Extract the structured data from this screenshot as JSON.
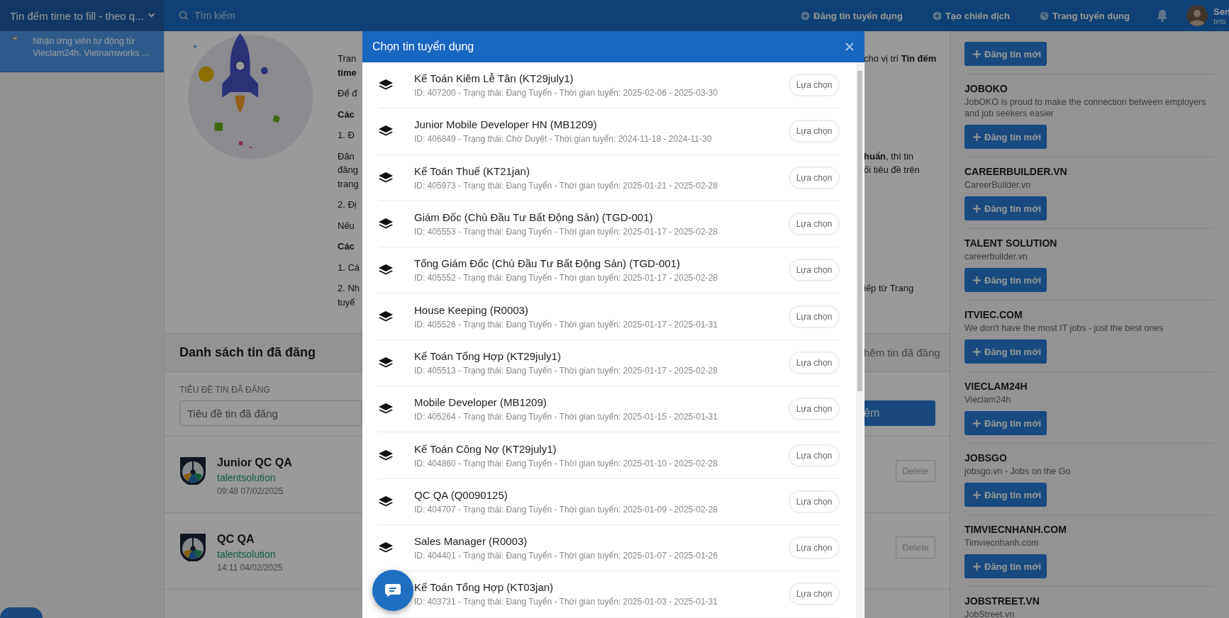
{
  "top_bar": {
    "workspace": "Tin đếm time to fill - theo q...",
    "search": {
      "placeholder": "Tìm kiếm"
    },
    "actions": [
      {
        "label": "Đăng tin tuyển dụng",
        "kind": "add"
      },
      {
        "label": "Tạo chiến dịch",
        "kind": "add"
      },
      {
        "label": "Trang tuyển dụng",
        "kind": "globe"
      }
    ],
    "user": {
      "name": "Sen",
      "subtitle": "tets"
    }
  },
  "sidebar": {
    "items": [
      {
        "description": "Nhận ứng viên tự động từ Vieclam24h, Vietnamworks ...",
        "selected": true
      }
    ]
  },
  "guide": {
    "paragraphs": [
      {
        "lines": [
          {
            "left": "Tran",
            "right": "cho vị trí **Tin đếm**",
            "bold": false
          },
          {
            "left": "time",
            "bold": true
          }
        ]
      },
      {
        "lines": [
          {
            "left": "Để đ",
            "bold": false
          }
        ]
      },
      {
        "lines": [
          {
            "left": "Các",
            "bold": true
          }
        ]
      },
      {
        "lines": [
          {
            "left": "1. Đ",
            "bold": false
          }
        ]
      },
      {
        "lines": [
          {
            "left": "Đăn",
            "right": "**huẩn**, thì tin",
            "bold": false
          },
          {
            "left": "đăng",
            "right": "ối tiêu đề trên",
            "bold": false
          },
          {
            "left": "trang",
            "bold": false
          }
        ]
      },
      {
        "lines": [
          {
            "left": "2. Đị",
            "bold": false
          }
        ]
      },
      {
        "lines": [
          {
            "left": "Nếu",
            "bold": false
          }
        ]
      },
      {
        "lines": [
          {
            "left": "Các",
            "bold": true
          }
        ]
      },
      {
        "lines": [
          {
            "left": "1. Cá",
            "bold": false
          }
        ]
      },
      {
        "lines": [
          {
            "left": "2. Nh",
            "right": "iếp từ Trang",
            "bold": false
          },
          {
            "left": "tuyể",
            "bold": false
          }
        ]
      }
    ]
  },
  "posted": {
    "title": "Danh sách tin đã đăng",
    "header_action": "hêm tin đã đăng",
    "filter_label": "TIÊU ĐỀ TIN ĐÃ ĐĂNG",
    "filter": {
      "placeholder": "Tiêu đề tin đã đăng"
    },
    "search_button": "êm",
    "items": [
      {
        "title": "Junior QC QA",
        "source": "talentsolution",
        "time": "09:48 07/02/2025",
        "action": "Delete"
      },
      {
        "title": "QC QA",
        "source": "talentsolution",
        "time": "14:11 04/02/2025",
        "action": "Delete"
      }
    ]
  },
  "channels": [
    {
      "button": "Đăng tin mới"
    },
    {
      "name": "JOBOKO",
      "description": "JobOKO is proud to make the connection between employers and job seekers easier",
      "button": "Đăng tin mới"
    },
    {
      "name": "CAREERBUILDER.VN",
      "description": "CareerBuilder.vn",
      "button": "Đăng tin mới"
    },
    {
      "name": "TALENT SOLUTION",
      "description": "careerbuilder.vn",
      "button": "Đăng tin mới"
    },
    {
      "name": "ITVIEC.COM",
      "description": "We don't have the most IT jobs - just the best ones",
      "button": "Đăng tin mới"
    },
    {
      "name": "VIECLAM24H",
      "description": "Vieclam24h",
      "button": "Đăng tin mới"
    },
    {
      "name": "JOBSGO",
      "description": "jobsgo.vn - Jobs on the Go",
      "button": "Đăng tin mới"
    },
    {
      "name": "TIMVIECNHANH.COM",
      "description": "Timviecnhanh.com",
      "button": "Đăng tin mới"
    },
    {
      "name": "JOBSTREET.VN",
      "description": "JobStreet.vn"
    }
  ],
  "modal": {
    "title": "Chọn tin tuyển dụng",
    "jobs": [
      {
        "title": "Kế Toán Kiêm Lễ Tân (KT29july1)",
        "details": "ID: 407200 - Trạng thái: Đang Tuyển - Thời gian tuyển: 2025-02-06 - 2025-03-30",
        "button": "Lựa chọn"
      },
      {
        "title": "Junior Mobile Developer HN (MB1209)",
        "details": "ID: 406849 - Trạng thái: Chờ Duyệt - Thời gian tuyển: 2024-11-18 - 2024-11-30",
        "button": "Lựa chọn"
      },
      {
        "title": "Kế Toán Thuế (KT21jan)",
        "details": "ID: 405973 - Trạng thái: Đang Tuyển - Thời gian tuyển: 2025-01-21 - 2025-02-28",
        "button": "Lựa chọn"
      },
      {
        "title": "Giám Đốc (Chủ Đầu Tư Bất Động Sản) (TGD-001)",
        "details": "ID: 405553 - Trạng thái: Đang Tuyển - Thời gian tuyển: 2025-01-17 - 2025-02-28",
        "button": "Lựa chọn"
      },
      {
        "title": "Tổng Giám Đốc (Chủ Đầu Tư Bất Động Sản) (TGD-001)",
        "details": "ID: 405552 - Trạng thái: Đang Tuyển - Thời gian tuyển: 2025-01-17 - 2025-02-28",
        "button": "Lựa chọn"
      },
      {
        "title": "House Keeping (R0003)",
        "details": "ID: 405526 - Trạng thái: Đang Tuyển - Thời gian tuyển: 2025-01-17 - 2025-01-31",
        "button": "Lựa chọn"
      },
      {
        "title": "Kế Toán Tổng Hợp (KT29july1)",
        "details": "ID: 405513 - Trạng thái: Đang Tuyển - Thời gian tuyển: 2025-01-17 - 2025-02-28",
        "button": "Lựa chọn"
      },
      {
        "title": "Mobile Developer (MB1209)",
        "details": "ID: 405264 - Trạng thái: Đang Tuyển - Thời gian tuyển: 2025-01-15 - 2025-01-31",
        "button": "Lựa chọn"
      },
      {
        "title": "Kế Toán Công Nợ (KT29july1)",
        "details": "ID: 404860 - Trạng thái: Đang Tuyển - Thời gian tuyển: 2025-01-10 - 2025-02-28",
        "button": "Lựa chọn"
      },
      {
        "title": "QC QA (Q0090125)",
        "details": "ID: 404707 - Trạng thái: Đang Tuyển - Thời gian tuyển: 2025-01-09 - 2025-02-28",
        "button": "Lựa chọn"
      },
      {
        "title": "Sales Manager (R0003)",
        "details": "ID: 404401 - Trạng thái: Đang Tuyển - Thời gian tuyển: 2025-01-07 - 2025-01-26",
        "button": "Lựa chọn"
      },
      {
        "title": "Kế Toán Tổng Hợp (KT03jan)",
        "details": "ID: 403731 - Trạng thái: Đang Tuyển - Thời gian tuyển: 2025-01-03 - 2025-01-31",
        "button": "Lựa chọn"
      }
    ]
  }
}
